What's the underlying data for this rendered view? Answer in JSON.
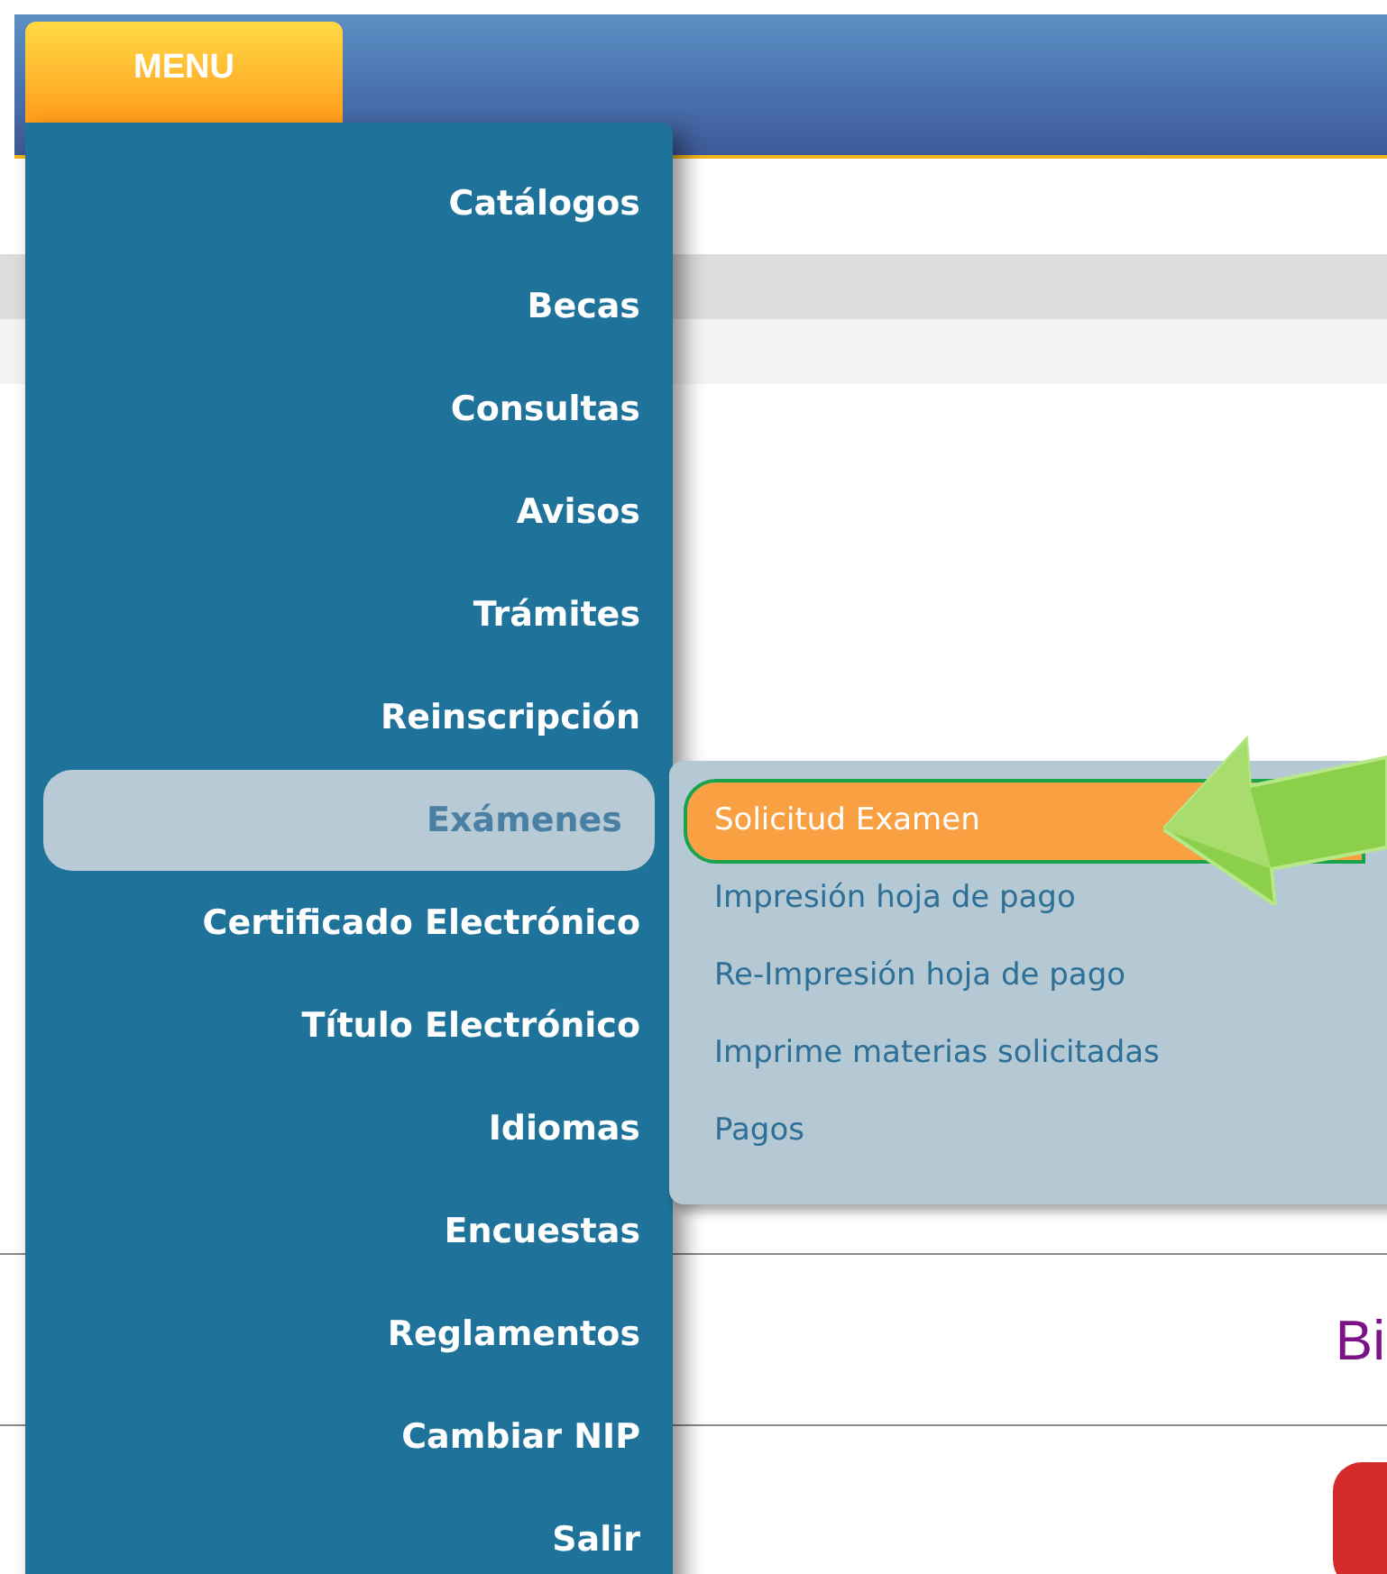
{
  "menu_button": {
    "label": "MENU",
    "expanded": true
  },
  "menu": {
    "items": [
      {
        "label": "Catálogos",
        "selected": false
      },
      {
        "label": "Becas",
        "selected": false
      },
      {
        "label": "Consultas",
        "selected": false
      },
      {
        "label": "Avisos",
        "selected": false
      },
      {
        "label": "Trámites",
        "selected": false
      },
      {
        "label": "Reinscripción",
        "selected": false
      },
      {
        "label": "Exámenes",
        "selected": true,
        "children": [
          {
            "label": "Solicitud Examen",
            "selected": true
          },
          {
            "label": "Impresión hoja de pago",
            "selected": false
          },
          {
            "label": "Re-Impresión hoja de pago",
            "selected": false
          },
          {
            "label": "Imprime materias solicitadas",
            "selected": false
          },
          {
            "label": "Pagos",
            "selected": false
          }
        ]
      },
      {
        "label": "Certificado Electrónico",
        "selected": false
      },
      {
        "label": "Título Electrónico",
        "selected": false
      },
      {
        "label": "Idiomas",
        "selected": false
      },
      {
        "label": "Encuestas",
        "selected": false
      },
      {
        "label": "Reglamentos",
        "selected": false
      },
      {
        "label": "Cambiar NIP",
        "selected": false
      },
      {
        "label": "Salir",
        "selected": false
      }
    ]
  },
  "content": {
    "heading": "Bi"
  }
}
